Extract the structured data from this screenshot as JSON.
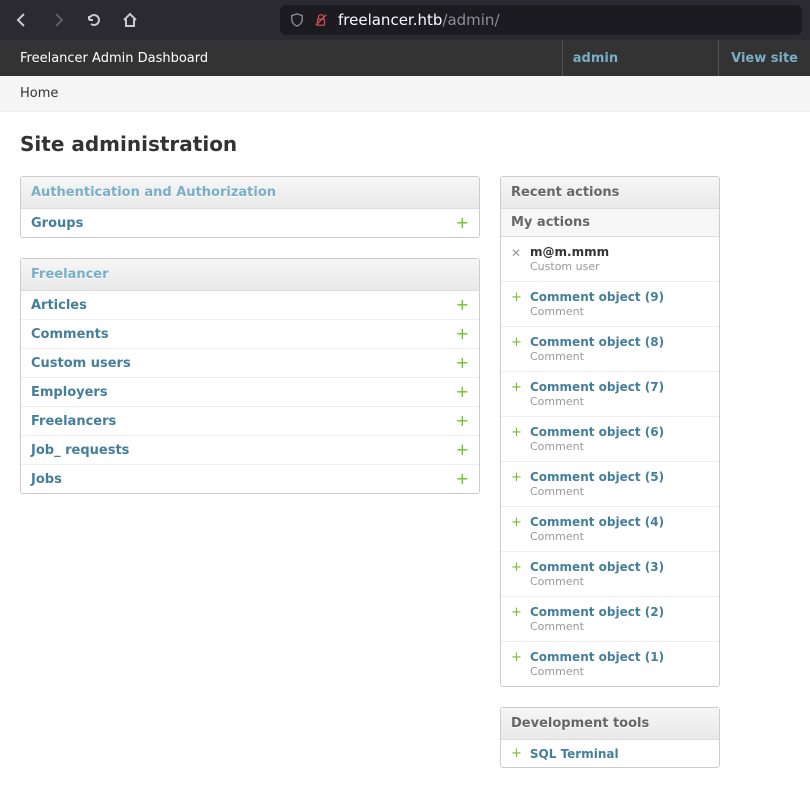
{
  "url": {
    "host": "freelancer.htb",
    "path": "/admin/"
  },
  "header": {
    "branding": "Freelancer Admin Dashboard",
    "user": "admin",
    "viewsite": "View site"
  },
  "breadcrumbs": {
    "home": "Home"
  },
  "page_title": "Site administration",
  "apps": [
    {
      "name": "Authentication and Authorization",
      "models": [
        {
          "name": "Groups",
          "add": "+"
        }
      ]
    },
    {
      "name": "Freelancer",
      "models": [
        {
          "name": "Articles",
          "add": "+"
        },
        {
          "name": "Comments",
          "add": "+"
        },
        {
          "name": "Custom users",
          "add": "+"
        },
        {
          "name": "Employers",
          "add": "+"
        },
        {
          "name": "Freelancers",
          "add": "+"
        },
        {
          "name": "Job_ requests",
          "add": "+"
        },
        {
          "name": "Jobs",
          "add": "+"
        }
      ]
    }
  ],
  "recent": {
    "heading": "Recent actions",
    "subheading": "My actions",
    "items": [
      {
        "kind": "delete",
        "title": "m@m.mmm",
        "sub": "Custom user"
      },
      {
        "kind": "add",
        "title": "Comment object (9)",
        "sub": "Comment"
      },
      {
        "kind": "add",
        "title": "Comment object (8)",
        "sub": "Comment"
      },
      {
        "kind": "add",
        "title": "Comment object (7)",
        "sub": "Comment"
      },
      {
        "kind": "add",
        "title": "Comment object (6)",
        "sub": "Comment"
      },
      {
        "kind": "add",
        "title": "Comment object (5)",
        "sub": "Comment"
      },
      {
        "kind": "add",
        "title": "Comment object (4)",
        "sub": "Comment"
      },
      {
        "kind": "add",
        "title": "Comment object (3)",
        "sub": "Comment"
      },
      {
        "kind": "add",
        "title": "Comment object (2)",
        "sub": "Comment"
      },
      {
        "kind": "add",
        "title": "Comment object (1)",
        "sub": "Comment"
      }
    ]
  },
  "devtools": {
    "heading": "Development tools",
    "items": [
      {
        "name": "SQL Terminal"
      }
    ]
  }
}
